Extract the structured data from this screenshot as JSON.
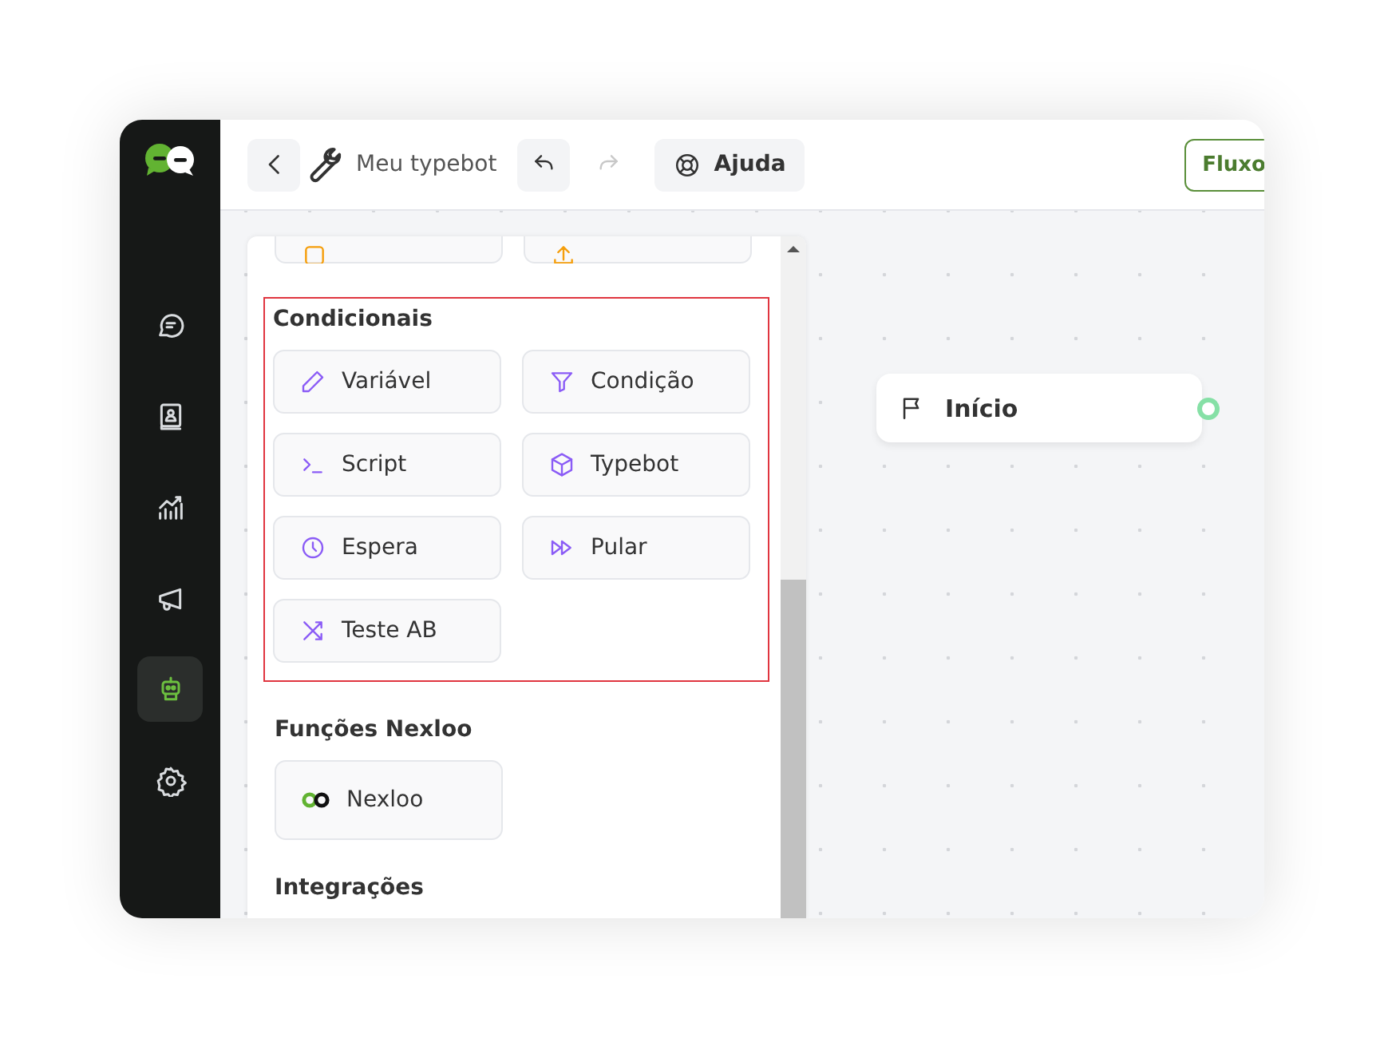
{
  "sidebar": {
    "items": [
      {
        "kind": "chat",
        "selected": false
      },
      {
        "kind": "contacts",
        "selected": false
      },
      {
        "kind": "analytics",
        "selected": false
      },
      {
        "kind": "campaigns",
        "selected": false
      },
      {
        "kind": "bot",
        "selected": true
      },
      {
        "kind": "settings",
        "selected": false
      }
    ]
  },
  "header": {
    "title": "Meu typebot",
    "undo": {
      "disabled": false
    },
    "redo": {
      "disabled": true
    },
    "help": "Ajuda",
    "flow_button": "Fluxo"
  },
  "panel": {
    "clipped_row": [
      {
        "kind": "button"
      },
      {
        "kind": "file"
      }
    ],
    "sections": [
      {
        "title": "Condicionais",
        "highlighted": true,
        "items": [
          {
            "label": "Variável",
            "kind": "variable"
          },
          {
            "label": "Condição",
            "kind": "condition"
          },
          {
            "label": "Script",
            "kind": "script"
          },
          {
            "label": "Typebot",
            "kind": "typebot"
          },
          {
            "label": "Espera",
            "kind": "wait"
          },
          {
            "label": "Pular",
            "kind": "jump"
          },
          {
            "label": "Teste AB",
            "kind": "abtest"
          }
        ]
      },
      {
        "title": "Funções Nexloo",
        "highlighted": false,
        "items": [
          {
            "label": "Nexloo",
            "kind": "nexloo"
          }
        ]
      },
      {
        "title": "Integrações",
        "highlighted": false
      }
    ]
  },
  "canvas": {
    "start_node": {
      "label": "Início"
    }
  }
}
